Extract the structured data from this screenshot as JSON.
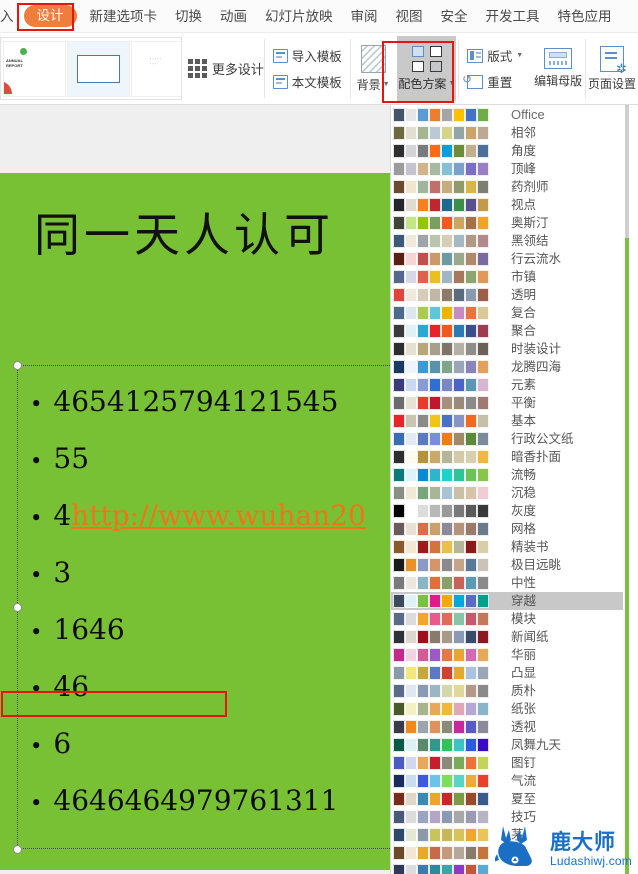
{
  "app": {
    "accent_orange": "#ef7d3c",
    "highlight_red": "#e8140f",
    "slide_green": "#79c134"
  },
  "tabbar": {
    "tabs": [
      {
        "label": "入",
        "active": false,
        "clipped": true
      },
      {
        "label": "设计",
        "active": true,
        "clipped": false
      },
      {
        "label": "新建选项卡",
        "active": false,
        "clipped": false
      },
      {
        "label": "切换",
        "active": false,
        "clipped": false
      },
      {
        "label": "动画",
        "active": false,
        "clipped": false
      },
      {
        "label": "幻灯片放映",
        "active": false,
        "clipped": false
      },
      {
        "label": "审阅",
        "active": false,
        "clipped": false
      },
      {
        "label": "视图",
        "active": false,
        "clipped": false
      },
      {
        "label": "安全",
        "active": false,
        "clipped": false
      },
      {
        "label": "开发工具",
        "active": false,
        "clipped": false
      },
      {
        "label": "特色应用",
        "active": false,
        "clipped": false
      }
    ]
  },
  "ribbon": {
    "more_design_label": "更多设计",
    "import_template_label": "导入模板",
    "this_template_label": "本文模板",
    "background_label": "背景",
    "colorscheme_label": "配色方案",
    "layout_label": "版式",
    "reset_label": "重置",
    "edit_master_label": "编辑母版",
    "page_setup_label": "页面设置"
  },
  "slide": {
    "title": "同一天人认可",
    "bullets": [
      {
        "text": "4654125794121545",
        "link": ""
      },
      {
        "text": "55",
        "link": ""
      },
      {
        "text": "4",
        "link": "http://www.wuhan20"
      },
      {
        "text": "3",
        "link": ""
      },
      {
        "text": "1646",
        "link": ""
      },
      {
        "text": "46",
        "link": ""
      },
      {
        "text": "6",
        "link": ""
      },
      {
        "text": "4646464979761311",
        "link": ""
      }
    ]
  },
  "dropdown": {
    "selected": "穿越",
    "themes": [
      {
        "name": "Office",
        "colors": [
          "#44546a",
          "#e7e6e6",
          "#5b9bd5",
          "#ed7d31",
          "#a5a5a5",
          "#ffc000",
          "#4472c4",
          "#70ad47"
        ]
      },
      {
        "name": "相邻",
        "colors": [
          "#6b6a42",
          "#e3ded1",
          "#a5b592",
          "#b9cad4",
          "#d4d58a",
          "#94a5a8",
          "#cba46a",
          "#bda893"
        ]
      },
      {
        "name": "角度",
        "colors": [
          "#2f2f31",
          "#d2d4d6",
          "#797b7e",
          "#f96a1b",
          "#0c9ed5",
          "#6c8c3c",
          "#c1af8d",
          "#4c7099"
        ]
      },
      {
        "name": "顶峰",
        "colors": [
          "#9c9c9c",
          "#c5c3d0",
          "#d2b48c",
          "#a8b9a2",
          "#86c0d8",
          "#7ba0c9",
          "#7b6ec7",
          "#9b7fc4"
        ]
      },
      {
        "name": "药剂师",
        "colors": [
          "#6b4a2f",
          "#efe6cf",
          "#a1b49c",
          "#c0706b",
          "#c6ad7d",
          "#8f9a6d",
          "#d9b54a",
          "#7d7f72"
        ]
      },
      {
        "name": "视点",
        "colors": [
          "#24262b",
          "#e0ddd0",
          "#f5821f",
          "#c0272d",
          "#1a6b8f",
          "#3b8f4a",
          "#5a4f8f",
          "#c19a4d"
        ]
      },
      {
        "name": "奥斯汀",
        "colors": [
          "#3e4537",
          "#c3e68b",
          "#94c600",
          "#7ba05b",
          "#f15a22",
          "#c9a66b",
          "#a5714a",
          "#f0a22e"
        ]
      },
      {
        "name": "黑领结",
        "colors": [
          "#3c5a78",
          "#efe9db",
          "#9fa4a8",
          "#b9c6ad",
          "#d6cdb8",
          "#a4b8c4",
          "#b09a87",
          "#b38a8a"
        ]
      },
      {
        "name": "行云流水",
        "colors": [
          "#5a1e12",
          "#f6d6d2",
          "#c0504d",
          "#c99a6b",
          "#6c9aa5",
          "#9aa98e",
          "#b08a6a",
          "#7b6a9c"
        ]
      },
      {
        "name": "市镇",
        "colors": [
          "#55678c",
          "#d6d9e4",
          "#e2614a",
          "#e8c01f",
          "#9fb7c4",
          "#a6795f",
          "#8da56f",
          "#e0995a"
        ]
      },
      {
        "name": "透明",
        "colors": [
          "#e0453d",
          "#efe9dd",
          "#d6cdb8",
          "#c0b8a4",
          "#8c7a6b",
          "#5a6b7d",
          "#8a9aae",
          "#9c5f4a"
        ]
      },
      {
        "name": "复合",
        "colors": [
          "#4c6b8c",
          "#dfe7ee",
          "#aacb4f",
          "#5bc8d8",
          "#f0b400",
          "#c58bc4",
          "#f07040",
          "#d9c89a"
        ]
      },
      {
        "name": "聚合",
        "colors": [
          "#3a3a3a",
          "#dff0f7",
          "#29a8d4",
          "#e8232a",
          "#f0591e",
          "#2e7ab5",
          "#3b4f8f",
          "#a03c52"
        ]
      },
      {
        "name": "时装设计",
        "colors": [
          "#2e2e2e",
          "#e5e0cf",
          "#b9a877",
          "#a8a08c",
          "#807468",
          "#b3b0a6",
          "#8f8d89",
          "#6b6257"
        ]
      },
      {
        "name": "龙腾四海",
        "colors": [
          "#1b3a63",
          "#eef4fa",
          "#3a9ad4",
          "#5a93a8",
          "#7fa58a",
          "#9aa5b5",
          "#8a84b8",
          "#e2a05c"
        ]
      },
      {
        "name": "元素",
        "colors": [
          "#3a3a7a",
          "#c9d7f0",
          "#8a9ad4",
          "#2e6fd4",
          "#7a87c4",
          "#4a63c4",
          "#5a96b5",
          "#d8b5d0"
        ]
      },
      {
        "name": "平衡",
        "colors": [
          "#6b6b6b",
          "#e6e2d6",
          "#e83a2d",
          "#c0182a",
          "#a89080",
          "#9a8a7a",
          "#8a8a8a",
          "#a07a72"
        ]
      },
      {
        "name": "基本",
        "colors": [
          "#e8242a",
          "#c9c5b0",
          "#8a8a8a",
          "#f0c419",
          "#4a72c4",
          "#8a94c4",
          "#f06a20",
          "#c5c0a8"
        ]
      },
      {
        "name": "行政公文纸",
        "colors": [
          "#3a6bb5",
          "#e4eaf4",
          "#5a7ac4",
          "#7a8ed4",
          "#f07a1e",
          "#a08a6b",
          "#5a8a3a",
          "#7a8a9a"
        ]
      },
      {
        "name": "暗香扑面",
        "colors": [
          "#2e2e2e",
          "#fdfaf0",
          "#b5933a",
          "#c9a96b",
          "#b5b59a",
          "#d4c9a8",
          "#d8cfae",
          "#f0b840"
        ]
      },
      {
        "name": "流畅",
        "colors": [
          "#0a7a7a",
          "#dff2fa",
          "#0a8ad4",
          "#2eb5c9",
          "#1ad4c9",
          "#2ec49a",
          "#6ac45a",
          "#8ac44a"
        ]
      },
      {
        "name": "沉稳",
        "colors": [
          "#8a8f86",
          "#efe9d6",
          "#7aa57a",
          "#a8b598",
          "#a8c4d4",
          "#c9c0a8",
          "#d8c4a8",
          "#f0cdd4"
        ]
      },
      {
        "name": "灰度",
        "colors": [
          "#000000",
          "#ffffff",
          "#dcdcdc",
          "#b8b8b8",
          "#9a9a9a",
          "#7a7a7a",
          "#5a5a5a",
          "#3a3a3a"
        ]
      },
      {
        "name": "网格",
        "colors": [
          "#6b5a5a",
          "#e9e2d4",
          "#e06a4a",
          "#c9a06b",
          "#8a8a9a",
          "#b5937a",
          "#9a7a6b",
          "#6b7a8a"
        ]
      },
      {
        "name": "精装书",
        "colors": [
          "#8a5a2a",
          "#f0ead4",
          "#a01a1a",
          "#d4743a",
          "#e8c04a",
          "#b5b59a",
          "#8a1a1a",
          "#d8cfa8"
        ]
      },
      {
        "name": "极目远眺",
        "colors": [
          "#1a1a1a",
          "#e8922a",
          "#8a9ac4",
          "#d4956b",
          "#8a8a8a",
          "#c4a58a",
          "#5a7a9a",
          "#c9c4b5"
        ]
      },
      {
        "name": "中性",
        "colors": [
          "#7a7a7a",
          "#ece8df",
          "#8ab5c4",
          "#e0703a",
          "#8aa06b",
          "#c9635a",
          "#5a9ab5",
          "#8a8a8a"
        ]
      },
      {
        "name": "穿越",
        "colors": [
          "#3b4a5c",
          "#dff0f7",
          "#7ac143",
          "#e8178a",
          "#f5a800",
          "#00a8e0",
          "#5a6bc4",
          "#00a08a"
        ]
      },
      {
        "name": "模块",
        "colors": [
          "#5a6b8a",
          "#dcdcdc",
          "#f0a82a",
          "#e85a8a",
          "#e06a5a",
          "#8ac4a8",
          "#c45a6b",
          "#c4785a"
        ]
      },
      {
        "name": "新闻纸",
        "colors": [
          "#2e3238",
          "#dcd8cf",
          "#a0101a",
          "#8a7a6b",
          "#a8998a",
          "#8a9ab5",
          "#3a4a6b",
          "#8a1a20"
        ]
      },
      {
        "name": "华丽",
        "colors": [
          "#c42a8a",
          "#f0d4e4",
          "#d45a9a",
          "#9a5ac4",
          "#e07a4a",
          "#e0a83a",
          "#d46ab5",
          "#e8a85a"
        ]
      },
      {
        "name": "凸显",
        "colors": [
          "#8a9aa8",
          "#f5e87a",
          "#c9a83a",
          "#5a7ac4",
          "#d4402a",
          "#e8a82a",
          "#aac4e0",
          "#9aa5b5"
        ]
      },
      {
        "name": "质朴",
        "colors": [
          "#5a6b8a",
          "#dfe7ef",
          "#8a9ab5",
          "#9ab5c4",
          "#d4d8a8",
          "#e0d89a",
          "#b59a8a",
          "#8a8a8a"
        ]
      },
      {
        "name": "纸张",
        "colors": [
          "#4a5a2a",
          "#f5f0c4",
          "#a8b58a",
          "#e8a85a",
          "#f0b83a",
          "#e0a8b5",
          "#b5a8d4",
          "#8ab5c9"
        ]
      },
      {
        "name": "透视",
        "colors": [
          "#3a3a4a",
          "#f08a1a",
          "#9aa5ae",
          "#e0925a",
          "#8a8a7a",
          "#c42a9a",
          "#5a5ac4",
          "#8a8a9a"
        ]
      },
      {
        "name": "凤舞九天",
        "colors": [
          "#0a5a4a",
          "#dff0f2",
          "#5a8a6b",
          "#2e9a8a",
          "#2ec45a",
          "#3ac4c4",
          "#2a5ae0",
          "#3a0ac4"
        ]
      },
      {
        "name": "图钉",
        "colors": [
          "#4a5ac4",
          "#cfd8ee",
          "#e8a85a",
          "#c4202a",
          "#8a8a7a",
          "#7aab5a",
          "#f0703a",
          "#c4d45a"
        ]
      },
      {
        "name": "气流",
        "colors": [
          "#1a2a5c",
          "#c9dcf0",
          "#3a5ae0",
          "#6ac4e8",
          "#7ae05a",
          "#5ad4c4",
          "#f0a83a",
          "#e8402a"
        ]
      },
      {
        "name": "夏至",
        "colors": [
          "#7a2a1a",
          "#e0d8c4",
          "#3a8ab5",
          "#e8a82a",
          "#c42a2a",
          "#7a9a4a",
          "#9a4a2a",
          "#3a5a8a"
        ]
      },
      {
        "name": "技巧",
        "colors": [
          "#4a5a7a",
          "#dcdcdc",
          "#9aa5c4",
          "#b5a5c4",
          "#8a9ab5",
          "#a8a8a8",
          "#9a9ab5",
          "#b5b5c4"
        ]
      },
      {
        "name": "茅",
        "colors": [
          "#2e4a6b",
          "#e4e8d4",
          "#8a9aa8",
          "#c9c45a",
          "#c4b85a",
          "#d4c45a",
          "#f0a82a",
          "#e8c45a"
        ]
      },
      {
        "name": "",
        "colors": [
          "#6b4a2a",
          "#f0e8d4",
          "#e8a82a",
          "#c46b4a",
          "#c49a7a",
          "#b5a89a",
          "#8a7a6b",
          "#c4763a"
        ]
      },
      {
        "name": "",
        "colors": [
          "#2e3a5c",
          "#dcdcdc",
          "#3a7ab5",
          "#2e8a9a",
          "#3aa5a8",
          "#8a3ac4",
          "#c4563a",
          "#5aaad4"
        ]
      }
    ]
  },
  "watermark": {
    "brand_cn": "鹿大师",
    "brand_en": "Ludashiwj.com",
    "color": "#1a6fc4"
  }
}
